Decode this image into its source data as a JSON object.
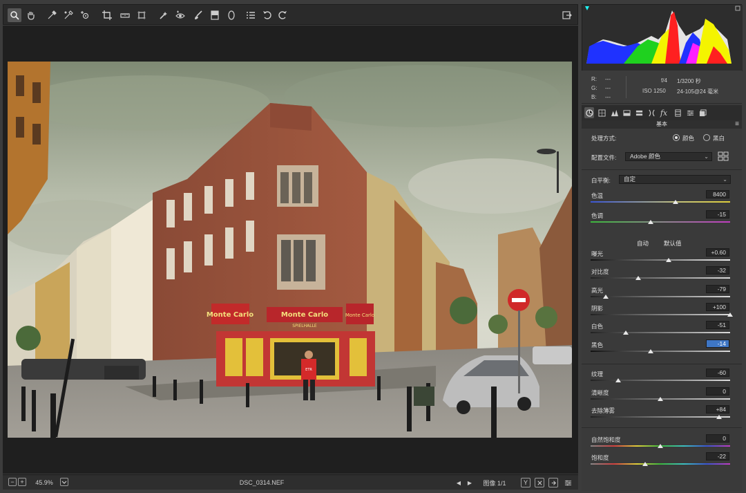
{
  "toolbar": {
    "tools": [
      "zoom-tool",
      "hand-tool",
      "white-balance-tool",
      "color-sampler-tool",
      "targeted-adjustment-tool",
      "crop-tool",
      "straighten-tool",
      "transform-tool",
      "spot-removal-tool",
      "red-eye-tool",
      "adjustment-brush",
      "graduated-filter",
      "radial-filter",
      "presets-list",
      "rotate-ccw",
      "rotate-cw"
    ],
    "right_icon": "open-image-icon"
  },
  "histogram": {
    "colors": {
      "red": "#ff2020",
      "green": "#1fd11f",
      "blue": "#1f32ff",
      "yellow": "#f4f400",
      "magenta": "#ff1fff",
      "cyan": "#1ff4f4",
      "white": "#e8e8e8"
    }
  },
  "info": {
    "r_label": "R:",
    "g_label": "G:",
    "b_label": "B:",
    "r_value": "---",
    "g_value": "---",
    "b_value": "---",
    "aperture": "f/4",
    "shutter": "1/3200 秒",
    "iso": "ISO 1250",
    "lens": "24-105@24 毫米"
  },
  "panel": {
    "section_title": "基本",
    "treatment_label": "处理方式:",
    "treatment_color": "颜色",
    "treatment_bw": "黑白",
    "profile_label": "配置文件:",
    "profile_value": "Adobe 颜色",
    "wb_label": "白平衡:",
    "wb_value": "自定",
    "auto_link": "自动",
    "default_link": "默认值"
  },
  "sliders": [
    {
      "label": "色温",
      "value": "8400",
      "fraction": 0.61
    },
    {
      "label": "色调",
      "value": "-15",
      "fraction": 0.43
    },
    {
      "label": "曝光",
      "value": "+0.60",
      "fraction": 0.56
    },
    {
      "label": "对比度",
      "value": "-32",
      "fraction": 0.34
    },
    {
      "label": "高光",
      "value": "-79",
      "fraction": 0.11
    },
    {
      "label": "阴影",
      "value": "+100",
      "fraction": 1.0
    },
    {
      "label": "白色",
      "value": "-51",
      "fraction": 0.25
    },
    {
      "label": "黑色",
      "value": "-14",
      "fraction": 0.43
    },
    {
      "label": "纹理",
      "value": "-60",
      "fraction": 0.2
    },
    {
      "label": "清晰度",
      "value": "0",
      "fraction": 0.5
    },
    {
      "label": "去除薄雾",
      "value": "+84",
      "fraction": 0.92
    },
    {
      "label": "自然饱和度",
      "value": "0",
      "fraction": 0.5
    },
    {
      "label": "饱和度",
      "value": "-22",
      "fraction": 0.39
    }
  ],
  "status": {
    "zoom_out": "−",
    "zoom_in": "+",
    "zoom_value": "45.9%",
    "filename": "DSC_0314.NEF",
    "image_counter": "图像 1/1",
    "prev": "◀",
    "next": "▶",
    "view_toggle": "Y"
  },
  "photo": {
    "shop_sign_left": "Monte Carlo",
    "shop_sign_center": "Monte Carlo",
    "shop_sign_small": "SPIELHALLE",
    "shop_sign_right": "Monte Carlo",
    "shirt_text": "ETR"
  }
}
